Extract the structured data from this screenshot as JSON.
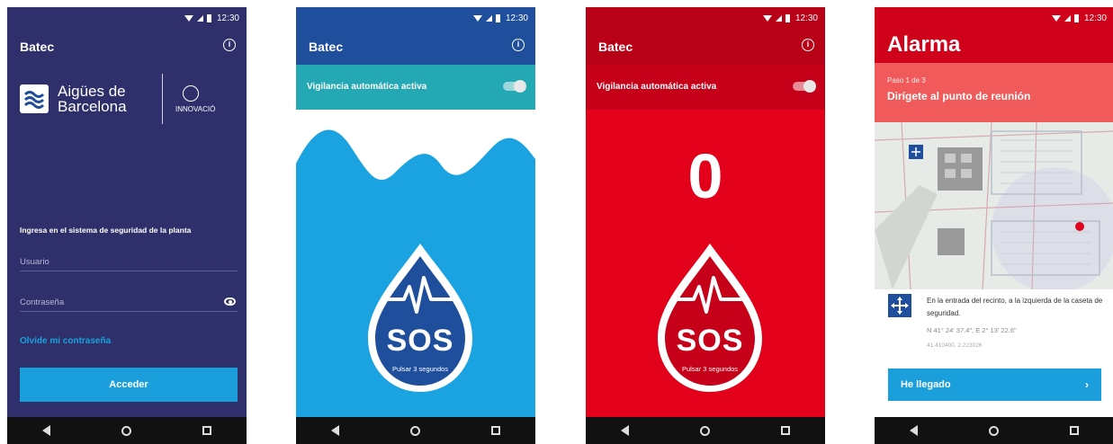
{
  "status_bar": {
    "time": "12:30"
  },
  "screen1": {
    "app_title": "Batec",
    "info_icon": "info-icon",
    "logo_name": "Aigües de Barcelona",
    "partner_label": "INNOVACIÓ",
    "prompt": "Ingresa en el sistema de seguridad de la planta",
    "user_placeholder": "Usuario",
    "password_placeholder": "Contraseña",
    "forgot_link": "Olvide mi contraseña",
    "login_button": "Acceder",
    "colors": {
      "background": "#2f2f6b",
      "accent": "#1a9fdc"
    }
  },
  "screen2": {
    "app_title": "Batec",
    "auto_label": "Vigilancia automática activa",
    "sos_label": "SOS",
    "sos_hint": "Pulsar 3 segundos",
    "colors": {
      "appbar": "#1f4f9c",
      "bar": "#24a8b3",
      "water": "#1aa3e0"
    }
  },
  "screen3": {
    "app_title": "Batec",
    "auto_label": "Vigilancia automática activa",
    "countdown": "0",
    "sos_label": "SOS",
    "sos_hint": "Pulsar 3 segundos",
    "colors": {
      "background": "#e2001a"
    }
  },
  "screen4": {
    "title": "Alarma",
    "step": "Paso 1 de 3",
    "goal": "Dirígete al punto de reunión",
    "description": "En la entrada del recinto, a la izquierda de la caseta de seguridad.",
    "coords_dms": "N 41° 24' 37.4\", E 2° 13' 22.6\"",
    "coords_dec": "41.410400, 2.223026",
    "arrived_button": "He llegado",
    "colors": {
      "header": "#d0021b",
      "step_bar": "#f15a5a"
    }
  }
}
